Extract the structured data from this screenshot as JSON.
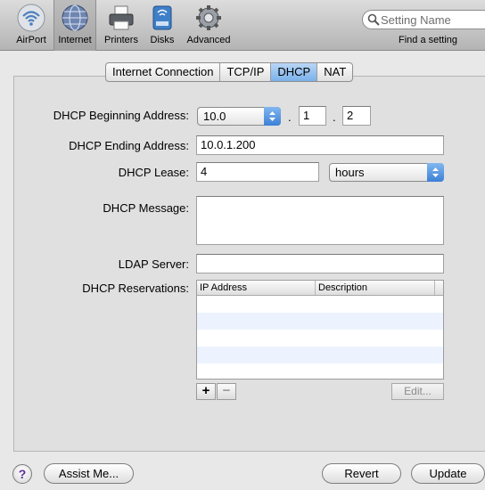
{
  "toolbar": {
    "items": [
      {
        "label": "AirPort",
        "icon": "airport-wifi-icon"
      },
      {
        "label": "Internet",
        "icon": "internet-globe-icon",
        "selected": true
      },
      {
        "label": "Printers",
        "icon": "printer-icon"
      },
      {
        "label": "Disks",
        "icon": "disk-icon"
      },
      {
        "label": "Advanced",
        "icon": "gear-icon"
      }
    ],
    "search": {
      "placeholder": "Setting Name",
      "caption": "Find a setting"
    }
  },
  "tabs": [
    {
      "label": "Internet Connection"
    },
    {
      "label": "TCP/IP"
    },
    {
      "label": "DHCP",
      "active": true
    },
    {
      "label": "NAT"
    }
  ],
  "form": {
    "beginning_label": "DHCP Beginning Address:",
    "beginning_prefix": "10.0",
    "beginning_octet3": "1",
    "beginning_octet4": "2",
    "ending_label": "DHCP Ending Address:",
    "ending_value": "10.0.1.200",
    "lease_label": "DHCP Lease:",
    "lease_value": "4",
    "lease_unit": "hours",
    "message_label": "DHCP Message:",
    "message_value": "",
    "ldap_label": "LDAP Server:",
    "ldap_value": "",
    "reservations_label": "DHCP Reservations:"
  },
  "reservations_table": {
    "columns": [
      "IP Address",
      "Description"
    ],
    "rows": []
  },
  "table_buttons": {
    "add": "+",
    "remove": "−",
    "edit": "Edit..."
  },
  "bottom": {
    "help": "?",
    "assist": "Assist Me...",
    "revert": "Revert",
    "update": "Update"
  },
  "colors": {
    "accent": "#3c80d6",
    "alt_row": "#edf3fe"
  }
}
